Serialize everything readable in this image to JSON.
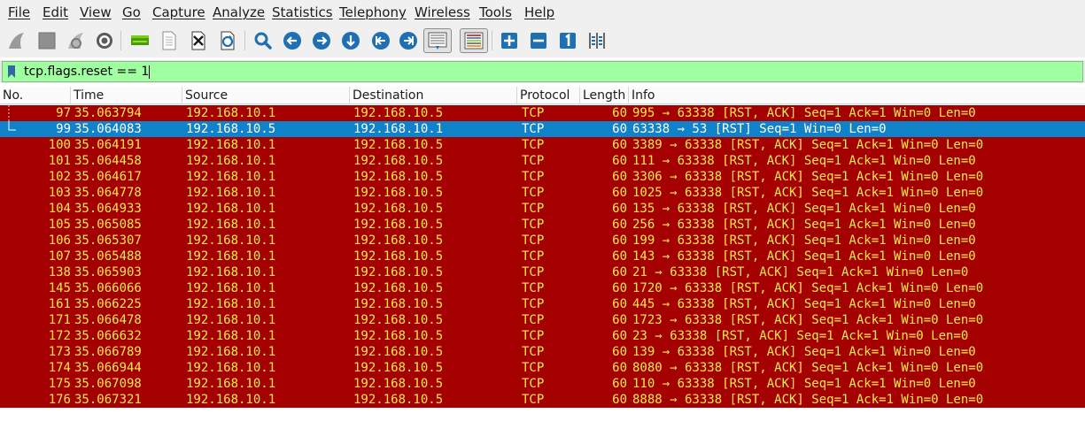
{
  "menu": [
    "File",
    "Edit",
    "View",
    "Go",
    "Capture",
    "Analyze",
    "Statistics",
    "Telephony",
    "Wireless",
    "Tools",
    "Help"
  ],
  "filter": {
    "value": "tcp.flags.reset == 1",
    "color": "#a0ffa0"
  },
  "columns": [
    "No.",
    "Time",
    "Source",
    "Destination",
    "Protocol",
    "Length",
    "Info"
  ],
  "colors": {
    "rst_row_bg": "#a40000",
    "rst_row_fg": "#fce94f",
    "selected_bg": "#0f82c9",
    "selected_fg": "#ffffff",
    "toolbar_blue": "#1f6fb4"
  },
  "packets": [
    {
      "no": "97",
      "time": "35.063794",
      "src": "192.168.10.1",
      "dst": "192.168.10.5",
      "proto": "TCP",
      "len": "60",
      "info": "995 → 63338 [RST, ACK] Seq=1 Ack=1 Win=0 Len=0"
    },
    {
      "no": "99",
      "time": "35.064083",
      "src": "192.168.10.5",
      "dst": "192.168.10.1",
      "proto": "TCP",
      "len": "60",
      "info": "63338 → 53 [RST] Seq=1 Win=0 Len=0",
      "selected": true
    },
    {
      "no": "100",
      "time": "35.064191",
      "src": "192.168.10.1",
      "dst": "192.168.10.5",
      "proto": "TCP",
      "len": "60",
      "info": "3389 → 63338 [RST, ACK] Seq=1 Ack=1 Win=0 Len=0"
    },
    {
      "no": "101",
      "time": "35.064458",
      "src": "192.168.10.1",
      "dst": "192.168.10.5",
      "proto": "TCP",
      "len": "60",
      "info": "111 → 63338 [RST, ACK] Seq=1 Ack=1 Win=0 Len=0"
    },
    {
      "no": "102",
      "time": "35.064617",
      "src": "192.168.10.1",
      "dst": "192.168.10.5",
      "proto": "TCP",
      "len": "60",
      "info": "3306 → 63338 [RST, ACK] Seq=1 Ack=1 Win=0 Len=0"
    },
    {
      "no": "103",
      "time": "35.064778",
      "src": "192.168.10.1",
      "dst": "192.168.10.5",
      "proto": "TCP",
      "len": "60",
      "info": "1025 → 63338 [RST, ACK] Seq=1 Ack=1 Win=0 Len=0"
    },
    {
      "no": "104",
      "time": "35.064933",
      "src": "192.168.10.1",
      "dst": "192.168.10.5",
      "proto": "TCP",
      "len": "60",
      "info": "135 → 63338 [RST, ACK] Seq=1 Ack=1 Win=0 Len=0"
    },
    {
      "no": "105",
      "time": "35.065085",
      "src": "192.168.10.1",
      "dst": "192.168.10.5",
      "proto": "TCP",
      "len": "60",
      "info": "256 → 63338 [RST, ACK] Seq=1 Ack=1 Win=0 Len=0"
    },
    {
      "no": "106",
      "time": "35.065307",
      "src": "192.168.10.1",
      "dst": "192.168.10.5",
      "proto": "TCP",
      "len": "60",
      "info": "199 → 63338 [RST, ACK] Seq=1 Ack=1 Win=0 Len=0"
    },
    {
      "no": "107",
      "time": "35.065488",
      "src": "192.168.10.1",
      "dst": "192.168.10.5",
      "proto": "TCP",
      "len": "60",
      "info": "143 → 63338 [RST, ACK] Seq=1 Ack=1 Win=0 Len=0"
    },
    {
      "no": "138",
      "time": "35.065903",
      "src": "192.168.10.1",
      "dst": "192.168.10.5",
      "proto": "TCP",
      "len": "60",
      "info": "21 → 63338 [RST, ACK] Seq=1 Ack=1 Win=0 Len=0"
    },
    {
      "no": "145",
      "time": "35.066066",
      "src": "192.168.10.1",
      "dst": "192.168.10.5",
      "proto": "TCP",
      "len": "60",
      "info": "1720 → 63338 [RST, ACK] Seq=1 Ack=1 Win=0 Len=0"
    },
    {
      "no": "161",
      "time": "35.066225",
      "src": "192.168.10.1",
      "dst": "192.168.10.5",
      "proto": "TCP",
      "len": "60",
      "info": "445 → 63338 [RST, ACK] Seq=1 Ack=1 Win=0 Len=0"
    },
    {
      "no": "171",
      "time": "35.066478",
      "src": "192.168.10.1",
      "dst": "192.168.10.5",
      "proto": "TCP",
      "len": "60",
      "info": "1723 → 63338 [RST, ACK] Seq=1 Ack=1 Win=0 Len=0"
    },
    {
      "no": "172",
      "time": "35.066632",
      "src": "192.168.10.1",
      "dst": "192.168.10.5",
      "proto": "TCP",
      "len": "60",
      "info": "23 → 63338 [RST, ACK] Seq=1 Ack=1 Win=0 Len=0"
    },
    {
      "no": "173",
      "time": "35.066789",
      "src": "192.168.10.1",
      "dst": "192.168.10.5",
      "proto": "TCP",
      "len": "60",
      "info": "139 → 63338 [RST, ACK] Seq=1 Ack=1 Win=0 Len=0"
    },
    {
      "no": "174",
      "time": "35.066944",
      "src": "192.168.10.1",
      "dst": "192.168.10.5",
      "proto": "TCP",
      "len": "60",
      "info": "8080 → 63338 [RST, ACK] Seq=1 Ack=1 Win=0 Len=0"
    },
    {
      "no": "175",
      "time": "35.067098",
      "src": "192.168.10.1",
      "dst": "192.168.10.5",
      "proto": "TCP",
      "len": "60",
      "info": "110 → 63338 [RST, ACK] Seq=1 Ack=1 Win=0 Len=0"
    },
    {
      "no": "176",
      "time": "35.067321",
      "src": "192.168.10.1",
      "dst": "192.168.10.5",
      "proto": "TCP",
      "len": "60",
      "info": "8888 → 63338 [RST, ACK] Seq=1 Ack=1 Win=0 Len=0"
    }
  ]
}
